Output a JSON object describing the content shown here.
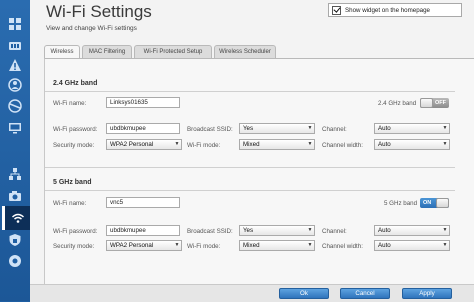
{
  "page": {
    "title": "Wi-Fi Settings",
    "subtitle": "View and change Wi-Fi settings",
    "show_widget_label": "Show widget on the homepage"
  },
  "tabs": [
    {
      "label": "Wireless",
      "active": true
    },
    {
      "label": "MAC Filtering",
      "active": false
    },
    {
      "label": "Wi-Fi Protected Setup",
      "active": false
    },
    {
      "label": "Wireless Scheduler",
      "active": false
    }
  ],
  "sidebar": {
    "icons": [
      "grid-icon",
      "router-icon",
      "warning-icon",
      "parental-controls-icon",
      "globe-icon",
      "monitor-icon",
      "network-icon",
      "camera-icon",
      "wifi-settings-icon",
      "security-icon",
      "troubleshoot-icon"
    ]
  },
  "band24": {
    "title": "2.4 GHz band",
    "wifi_name_label": "Wi-Fi name:",
    "wifi_name": "Linksys01635",
    "toggle_label": "2.4 GHz band",
    "toggle_state": "OFF",
    "password_label": "Wi-Fi password:",
    "password": "ubdbkmupee",
    "broadcast_label": "Broadcast SSID:",
    "broadcast_value": "Yes",
    "channel_label": "Channel:",
    "channel_value": "Auto",
    "security_label": "Security mode:",
    "security_value": "WPA2 Personal",
    "mode_label": "Wi-Fi mode:",
    "mode_value": "Mixed",
    "width_label": "Channel width:",
    "width_value": "Auto"
  },
  "band5": {
    "title": "5 GHz band",
    "wifi_name_label": "Wi-Fi name:",
    "wifi_name": "vnc5",
    "toggle_label": "5 GHz band",
    "toggle_state": "ON",
    "password_label": "Wi-Fi password:",
    "password": "ubdbkmupee",
    "broadcast_label": "Broadcast SSID:",
    "broadcast_value": "Yes",
    "channel_label": "Channel:",
    "channel_value": "Auto",
    "security_label": "Security mode:",
    "security_value": "WPA2 Personal",
    "mode_label": "Wi-Fi mode:",
    "mode_value": "Mixed",
    "width_label": "Channel width:",
    "width_value": "Auto"
  },
  "footer": {
    "ok": "Ok",
    "cancel": "Cancel",
    "apply": "Apply"
  },
  "colors": {
    "accent": "#2f74bc",
    "sidebar": "#1f5fa3"
  }
}
